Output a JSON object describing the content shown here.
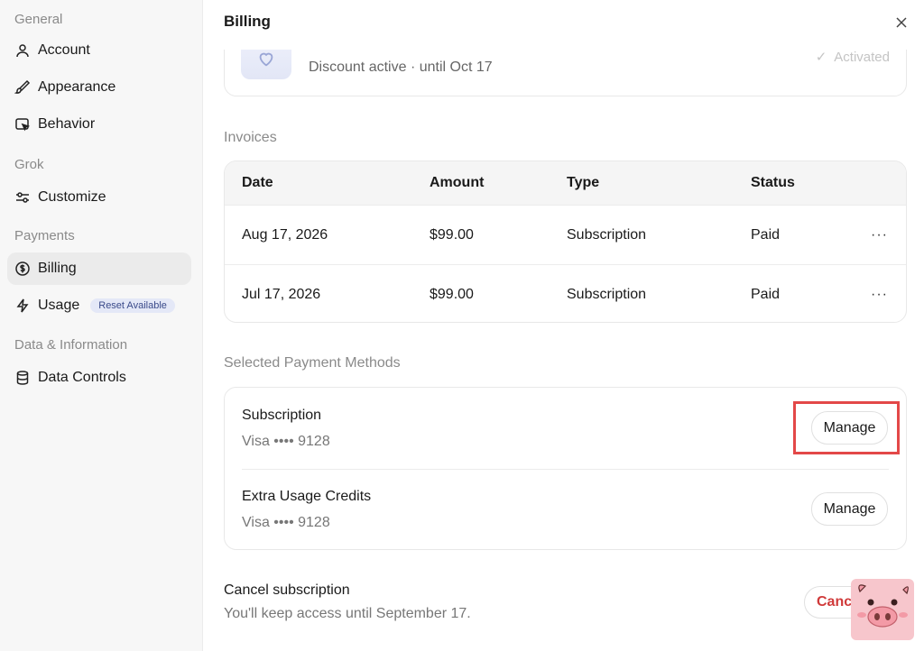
{
  "sidebar": {
    "sections": [
      {
        "label": "General",
        "items": [
          {
            "label": "Account",
            "icon": "user-icon"
          },
          {
            "label": "Appearance",
            "icon": "brush-icon"
          },
          {
            "label": "Behavior",
            "icon": "cursor-window-icon"
          }
        ]
      },
      {
        "label": "Grok",
        "items": [
          {
            "label": "Customize",
            "icon": "sliders-icon"
          }
        ]
      },
      {
        "label": "Payments",
        "items": [
          {
            "label": "Billing",
            "icon": "dollar-circle-icon",
            "active": true
          },
          {
            "label": "Usage",
            "icon": "bolt-icon",
            "badge": "Reset Available"
          }
        ]
      },
      {
        "label": "Data & Information",
        "items": [
          {
            "label": "Data Controls",
            "icon": "database-icon"
          }
        ]
      }
    ]
  },
  "main": {
    "title": "Billing",
    "discount": {
      "text": "Discount active · until Oct 17",
      "status": "Activated"
    },
    "invoices": {
      "heading": "Invoices",
      "columns": [
        "Date",
        "Amount",
        "Type",
        "Status"
      ],
      "rows": [
        {
          "date": "Aug 17, 2026",
          "amount": "$99.00",
          "type": "Subscription",
          "status": "Paid"
        },
        {
          "date": "Jul 17, 2026",
          "amount": "$99.00",
          "type": "Subscription",
          "status": "Paid"
        }
      ],
      "more_label": "···"
    },
    "payment_methods": {
      "heading": "Selected Payment Methods",
      "items": [
        {
          "name": "Subscription",
          "card": "Visa •••• 9128",
          "action": "Manage"
        },
        {
          "name": "Extra Usage Credits",
          "card": "Visa •••• 9128",
          "action": "Manage"
        }
      ]
    },
    "cancel": {
      "title": "Cancel subscription",
      "subtitle": "You'll keep access until September 17.",
      "button": "Cancel"
    }
  },
  "colors": {
    "accent_red": "#d03a3a",
    "highlight": "#e34848",
    "badge_bg": "#e4e8f7"
  }
}
